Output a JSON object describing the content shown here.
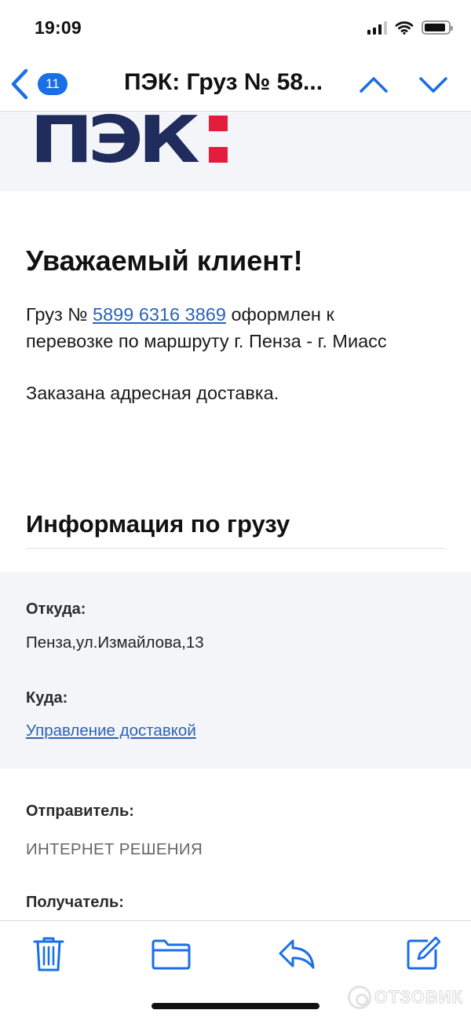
{
  "status_bar": {
    "time": "19:09",
    "signal_bars": 4,
    "signal_active": 3,
    "battery_level": 0.9
  },
  "nav": {
    "back_icon": "chevron-left-icon",
    "unread_count": "11",
    "title": "ПЭК: Груз № 58...",
    "prev_icon": "chevron-up-icon",
    "next_icon": "chevron-down-icon",
    "accent_color": "#1a6fe6"
  },
  "email": {
    "logo": {
      "text": "ПЭК",
      "brand_color": "#1f2c5c",
      "accent_color": "#e31e3c"
    },
    "greeting": "Уважаемый клиент!",
    "cargo_prefix": "Груз №",
    "cargo_number": "5899 6316 3869",
    "cargo_suffix": "оформлен к",
    "route_line": "перевозке по маршруту г. Пенза - г. Миасс",
    "delivery_note": "Заказана адресная доставка.",
    "section_title": "Информация по грузу",
    "from_label": "Откуда:",
    "from_value": "Пенза,ул.Измайлова,13",
    "to_label": "Куда:",
    "to_link": "Управление доставкой",
    "sender_label": "Отправитель:",
    "sender_value": "ИНТЕРНЕТ РЕШЕНИЯ",
    "recipient_label": "Получатель:",
    "link_color": "#2a62b8"
  },
  "toolbar": {
    "items": [
      "trash-icon",
      "folder-icon",
      "reply-icon",
      "compose-icon"
    ],
    "icon_color": "#1a6fe6"
  },
  "watermark": {
    "text": "ОТЗОВИК"
  }
}
